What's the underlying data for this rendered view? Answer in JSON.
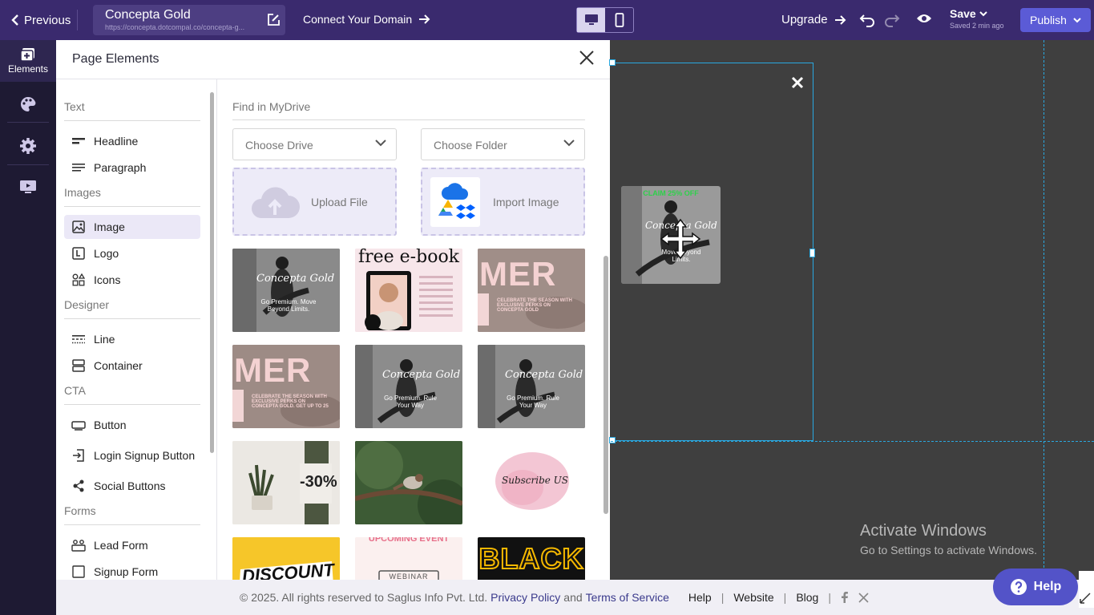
{
  "topbar": {
    "previous_label": "Previous",
    "site_name": "Concepta Gold",
    "site_url": "https://concepta.dotcompal.co/concepta-g...",
    "connect_label": "Connect Your Domain",
    "upgrade_label": "Upgrade",
    "save_label": "Save",
    "saved_status": "Saved 2 min ago",
    "publish_label": "Publish",
    "active_device": "desktop"
  },
  "rail": {
    "items": [
      {
        "label": "Elements",
        "icon": "elements-icon",
        "active": true
      },
      {
        "label": "",
        "icon": "palette-icon"
      },
      {
        "label": "",
        "icon": "gear-icon"
      },
      {
        "label": "",
        "icon": "monitor-icon"
      }
    ]
  },
  "panel": {
    "title": "Page Elements",
    "groups": [
      {
        "title": "Text",
        "items": [
          {
            "label": "Headline",
            "icon": "headline-icon"
          },
          {
            "label": "Paragraph",
            "icon": "paragraph-icon"
          }
        ]
      },
      {
        "title": "Images",
        "items": [
          {
            "label": "Image",
            "icon": "image-icon",
            "selected": true
          },
          {
            "label": "Logo",
            "icon": "logo-icon"
          },
          {
            "label": "Icons",
            "icon": "icons-icon"
          }
        ]
      },
      {
        "title": "Designer",
        "items": [
          {
            "label": "Line",
            "icon": "line-icon"
          },
          {
            "label": "Container",
            "icon": "container-icon"
          }
        ]
      },
      {
        "title": "CTA",
        "items": [
          {
            "label": "Button",
            "icon": "button-icon"
          },
          {
            "label": "Login Signup Button",
            "icon": "login-icon"
          },
          {
            "label": "Social Buttons",
            "icon": "share-icon"
          }
        ]
      },
      {
        "title": "Forms",
        "items": [
          {
            "label": "Lead Form",
            "icon": "lead-form-icon"
          },
          {
            "label": "Signup Form",
            "icon": "signup-form-icon"
          }
        ]
      }
    ],
    "media": {
      "find_label": "Find in MyDrive",
      "drive_placeholder": "Choose Drive",
      "folder_placeholder": "Choose Folder",
      "upload_label": "Upload File",
      "import_label": "Import Image",
      "thumbnails": [
        {
          "kind": "bw-dancer",
          "text": "Concepta Gold",
          "sub": "Go Premium. Move Beyond Limits."
        },
        {
          "kind": "ebook",
          "text": "free e-book"
        },
        {
          "kind": "summer",
          "text": "MER",
          "sub": "CELEBRATE THE SEASON WITH EXCLUSIVE PERKS ON CONCEPTA GOLD"
        },
        {
          "kind": "summer",
          "text": "MER",
          "sub": "CELEBRATE THE SEASON WITH EXCLUSIVE PERKS ON CONCEPTA GOLD. GET UP TO 25"
        },
        {
          "kind": "bw-dancer",
          "text": "Concepta Gold",
          "sub": "Go Premium. Rule Your Way"
        },
        {
          "kind": "bw-dancer",
          "text": "Concepta Gold",
          "sub": "Go Premium. Rule Your Way"
        },
        {
          "kind": "plant",
          "text": "-30%"
        },
        {
          "kind": "bird",
          "text": ""
        },
        {
          "kind": "subscribe",
          "text": "Subscribe US"
        },
        {
          "kind": "discount",
          "text": "DISCOUNT"
        },
        {
          "kind": "event",
          "text": "UPCOMING EVENT",
          "sub": "WEBINAR"
        },
        {
          "kind": "black",
          "text": "BLACK"
        }
      ]
    }
  },
  "canvas": {
    "image_text": "CLAIM 25% OFF",
    "image_title": "Concepta Gold",
    "image_sub": "Move Beyond Limits."
  },
  "watermark": {
    "line1": "Activate Windows",
    "line2": "Go to Settings to activate Windows."
  },
  "footer": {
    "copyright": "©  2025. All rights reserved to Saglus Info Pvt. Ltd.",
    "privacy": "Privacy Policy",
    "and": "and",
    "terms": "Terms of Service",
    "help": "Help",
    "website": "Website",
    "blog": "Blog"
  },
  "help_button": {
    "label": "Help"
  },
  "colors": {
    "topbar": "#3a2a6e",
    "accent": "#5b5bd6",
    "canvas": "#3f3f3f",
    "guide": "#29a8e0"
  }
}
